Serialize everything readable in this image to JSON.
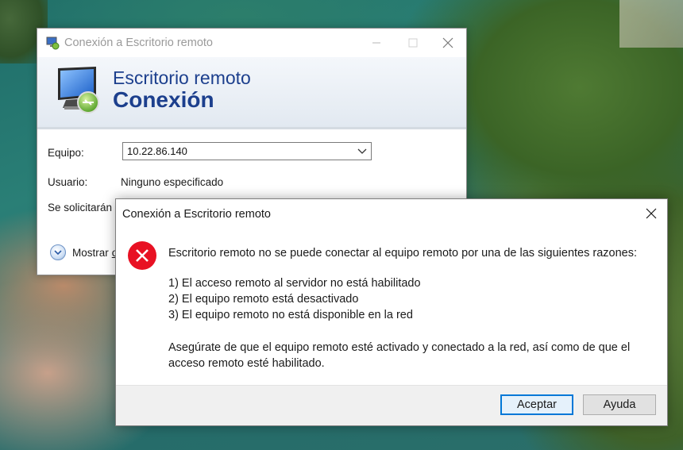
{
  "background_window": {
    "title": "Conexión a Escritorio remoto",
    "banner_line1": "Escritorio remoto",
    "banner_line2": "Conexión",
    "equipo_label": "Equipo:",
    "equipo_value": "10.22.86.140",
    "usuario_label": "Usuario:",
    "usuario_value": "Ninguno especificado",
    "credentials_label": "Se solicitarán",
    "show_label": "Mostrar",
    "show_link": "o",
    "icons": [
      "app-icon",
      "minimize-icon",
      "maximize-icon",
      "close-icon",
      "monitor-icon",
      "chevron-down-icon",
      "expand-options-icon"
    ]
  },
  "error_dialog": {
    "title": "Conexión a Escritorio remoto",
    "message": "Escritorio remoto no se puede conectar al equipo remoto por una de las siguientes razones:",
    "reasons": [
      "1) El acceso remoto al servidor no está habilitado",
      "2) El equipo remoto está desactivado",
      "3) El equipo remoto no está disponible en la red"
    ],
    "advice_line1": "Asegúrate de que el equipo remoto esté activado y conectado a la red, así como de que el",
    "advice_line2": "acceso remoto esté habilitado.",
    "accept_button": "Aceptar",
    "help_button": "Ayuda",
    "icons": [
      "error-icon",
      "close-icon"
    ],
    "colors": {
      "error_red": "#e81123",
      "accent_blue": "#0078d7"
    }
  }
}
